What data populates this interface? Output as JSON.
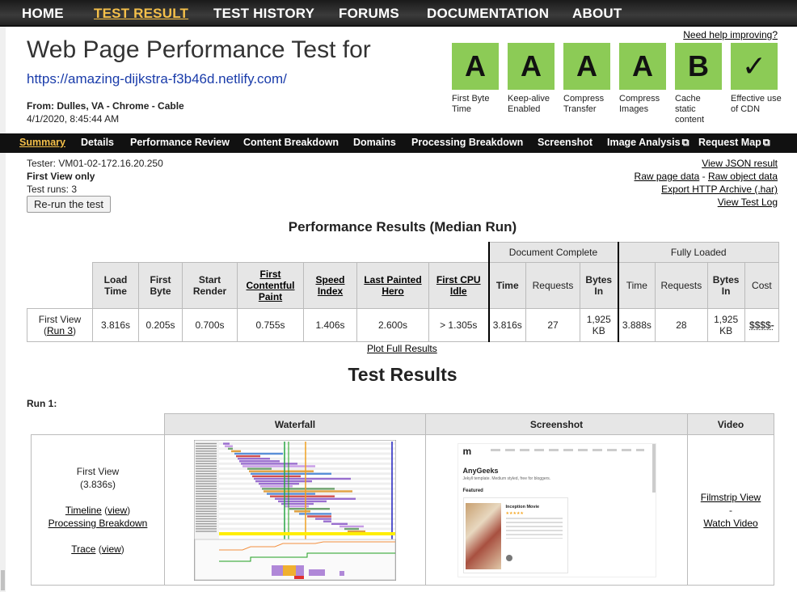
{
  "topnav": [
    "HOME",
    "TEST RESULT",
    "TEST HISTORY",
    "FORUMS",
    "DOCUMENTATION",
    "ABOUT"
  ],
  "header": {
    "title": "Web Page Performance Test for",
    "url": "https://amazing-dijkstra-f3b46d.netlify.com/",
    "from_label": "From:",
    "from_value": "Dulles, VA - Chrome - Cable",
    "date": "4/1/2020, 8:45:44 AM",
    "help": "Need help improving?"
  },
  "grades": [
    {
      "grade": "A",
      "label": "First Byte Time"
    },
    {
      "grade": "A",
      "label": "Keep-alive Enabled"
    },
    {
      "grade": "A",
      "label": "Compress Transfer"
    },
    {
      "grade": "A",
      "label": "Compress Images"
    },
    {
      "grade": "B",
      "label": "Cache static content"
    },
    {
      "grade": "✓",
      "label": "Effective use of CDN"
    }
  ],
  "subnav": [
    "Summary",
    "Details",
    "Performance Review",
    "Content Breakdown",
    "Domains",
    "Processing Breakdown",
    "Screenshot",
    "Image Analysis",
    "Request Map"
  ],
  "info": {
    "tester": "Tester: VM01-02-172.16.20.250",
    "view": "First View only",
    "runs": "Test runs: 3",
    "rerun": "Re-run the test",
    "links": [
      "View JSON result",
      "Raw page data",
      "Raw object data",
      "Export HTTP Archive (.har)",
      "View Test Log"
    ],
    "dash": " - "
  },
  "perf": {
    "title": "Performance Results (Median Run)",
    "group_doc": "Document Complete",
    "group_full": "Fully Loaded",
    "headers": [
      "Load Time",
      "First Byte",
      "Start Render",
      "First Contentful Paint",
      "Speed Index",
      "Last Painted Hero",
      "First CPU Idle",
      "Time",
      "Requests",
      "Bytes In",
      "Time",
      "Requests",
      "Bytes In",
      "Cost"
    ],
    "row_label": "First View",
    "row_run": "Run 3",
    "row": [
      "3.816s",
      "0.205s",
      "0.700s",
      "0.755s",
      "1.406s",
      "2.600s",
      "> 1.305s",
      "3.816s",
      "27",
      "1,925 KB",
      "3.888s",
      "28",
      "1,925 KB",
      "$$$$-"
    ],
    "plot_full": "Plot Full Results"
  },
  "results": {
    "title": "Test Results",
    "run": "Run 1:",
    "col_waterfall": "Waterfall",
    "col_screenshot": "Screenshot",
    "col_video": "Video",
    "first_view": "First View",
    "first_view_time": "(3.836s)",
    "timeline": "Timeline",
    "view": "view",
    "processing": "Processing Breakdown",
    "trace": "Trace",
    "filmstrip": "Filmstrip View",
    "dash": "-",
    "watch": "Watch Video"
  },
  "screenshot": {
    "logo": "m",
    "site": "AnyGeeks",
    "tagline": "Jekyll template. Medium styled, free for bloggers.",
    "featured": "Featured",
    "card_title": "Inception Movie"
  },
  "colors": {
    "grade_bg": "#8ccb56",
    "accent": "#f5c04a",
    "url": "#1a3caa"
  }
}
